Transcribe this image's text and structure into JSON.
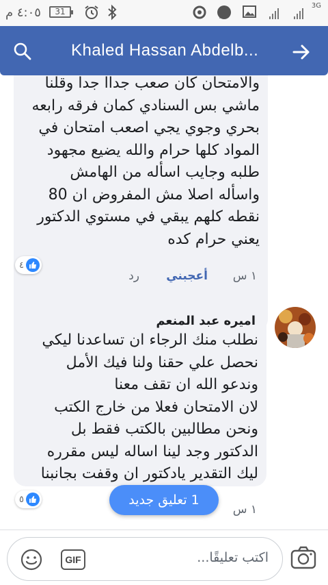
{
  "status_bar": {
    "time": "٤:٠٥ م",
    "battery": "31",
    "network": "3G",
    "icons": [
      "alarm-icon",
      "bluetooth-icon",
      "sync-icon",
      "whatsapp-icon",
      "gallery-icon",
      "signal-icon"
    ]
  },
  "header": {
    "title": "Khaled Hassan Abdelb...",
    "search_icon": "search-icon",
    "forward_icon": "arrow-right-icon",
    "background": "#4267b2"
  },
  "comments": [
    {
      "text": "والامتحان كان صعب جداا جدا وقلنا\nماشي بس السنادي كمان فرقه رابعه\nبحري وجوي يجي اصعب امتحان في\nالمواد كلها حرام والله يضيع مجهود\nطلبه وجايب اسأله من الهامش\nواسأله اصلا مش المفروض ان 80\nنقطه كلهم يبقي في مستوي الدكتور\nيعني حرام كده",
      "time": "١ س",
      "like_label": "أعجبني",
      "reply_label": "رد",
      "reaction_count": "٤"
    },
    {
      "author": "اميره عبد المنعم",
      "text": "نطلب منك الرجاء ان تساعدنا ليكي\nنحصل علي حقنا ولنا فيك الأمل\nوندعو الله ان تقف معنا\nلان الامتحان فعلا من خارج الكتب\nونحن مطالبين بالكتب فقط بل\nالدكتور وجد لينا اساله ليس مقرره\nليك التقدير يادكتور ان وقفت بجانبنا",
      "time": "١ س",
      "reaction_count": "٥"
    }
  ],
  "new_comment_button": "1 تعليق جديد",
  "composer": {
    "placeholder": "اكتب تعليقًا...",
    "gif_label": "GIF",
    "emoji_icon": "emoji-icon",
    "camera_icon": "camera-icon"
  },
  "colors": {
    "accent": "#4267b2",
    "like_blue": "#2d88ff",
    "bubble_bg": "#f1f2f6",
    "new_comment_bg": "#4b8ef9"
  }
}
